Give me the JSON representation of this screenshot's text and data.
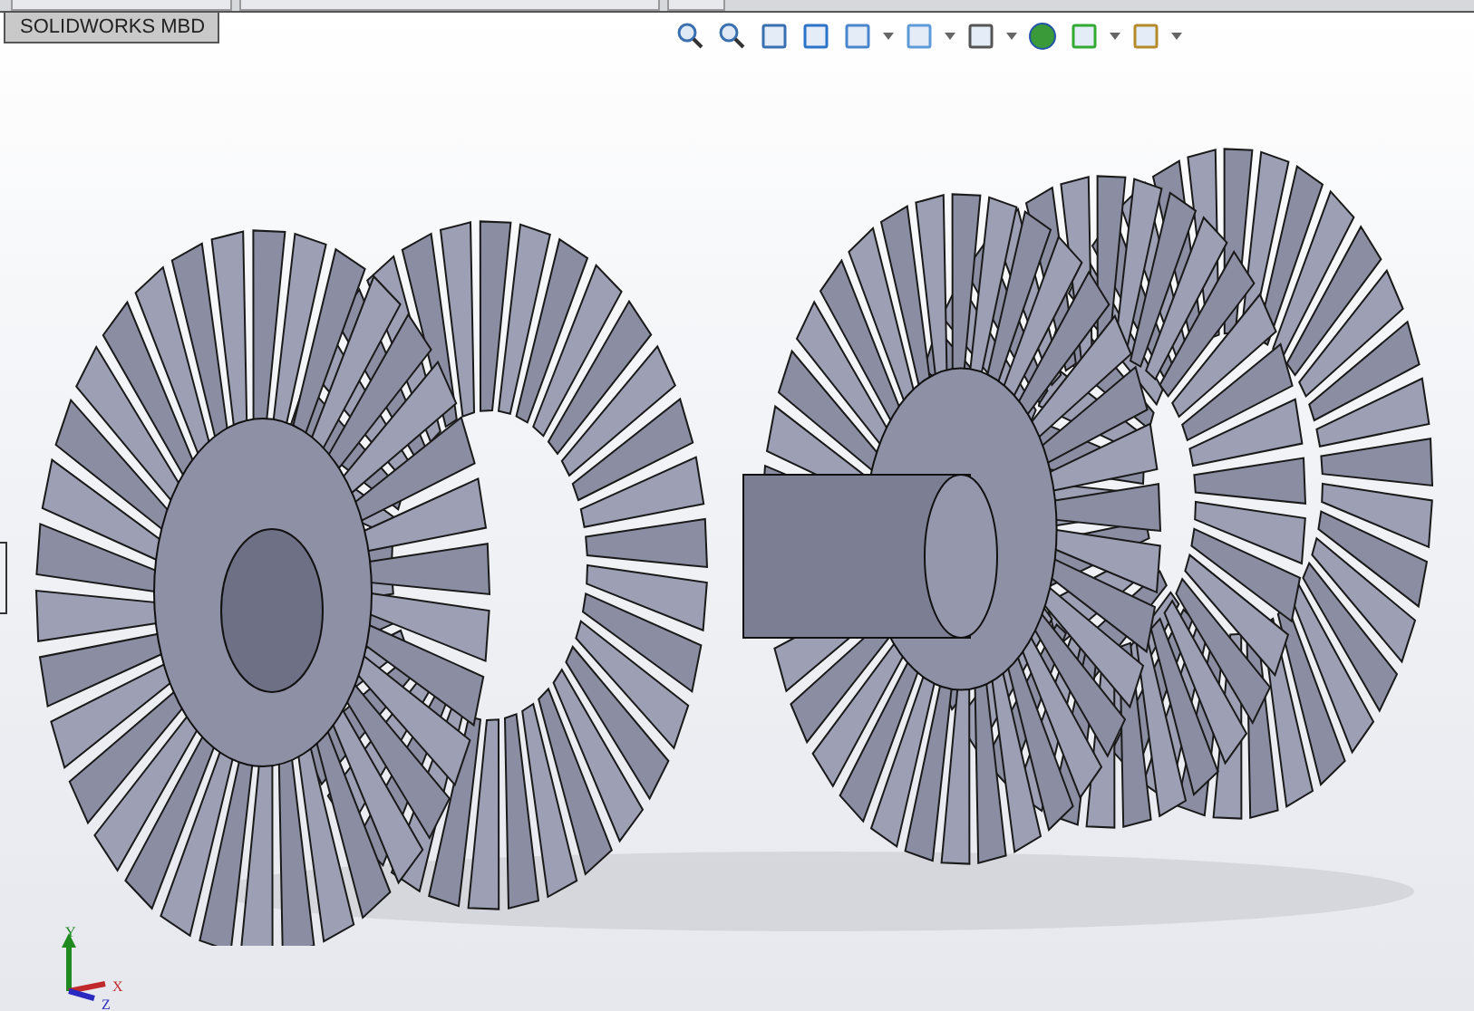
{
  "tab": {
    "label": "SOLIDWORKS MBD"
  },
  "triad": {
    "axes": [
      "Y",
      "X",
      "Z"
    ]
  }
}
